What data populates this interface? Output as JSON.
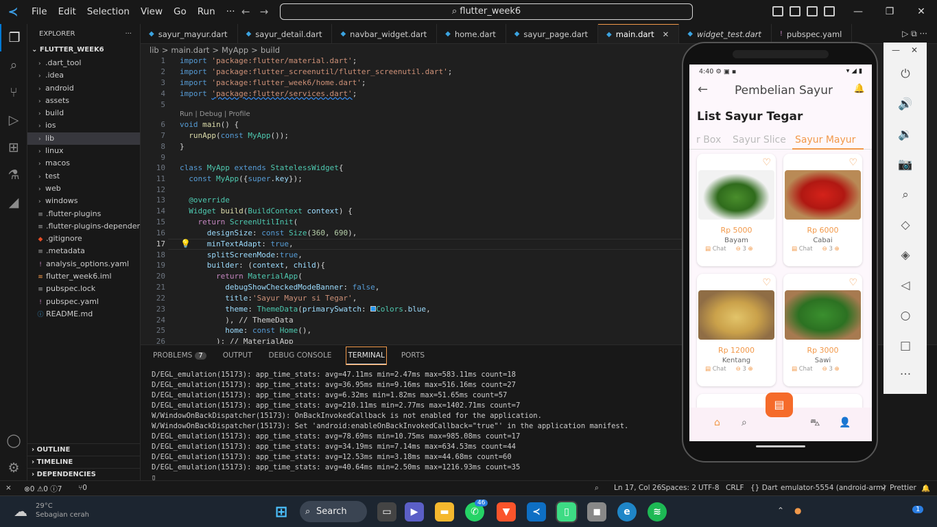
{
  "titlebar": {
    "menu": [
      "File",
      "Edit",
      "Selection",
      "View",
      "Go",
      "Run",
      "···"
    ],
    "search": "flutter_week6"
  },
  "explorer": {
    "header": "EXPLORER",
    "root": "FLUTTER_WEEK6",
    "folders": [
      ".dart_tool",
      ".idea",
      "android",
      "assets",
      "build",
      "ios",
      "lib",
      "linux",
      "macos",
      "test",
      "web",
      "windows"
    ],
    "files": [
      ".flutter-plugins",
      ".flutter-plugins-dependen...",
      ".gitignore",
      ".metadata",
      "analysis_options.yaml",
      "flutter_week6.iml",
      "pubspec.lock",
      "pubspec.yaml",
      "README.md"
    ],
    "sections": [
      "OUTLINE",
      "TIMELINE",
      "DEPENDENCIES"
    ]
  },
  "tabs": [
    "sayur_mayur.dart",
    "sayur_detail.dart",
    "navbar_widget.dart",
    "home.dart",
    "sayur_page.dart",
    "main.dart",
    "widget_test.dart",
    "pubspec.yaml"
  ],
  "breadcrumb": [
    "lib",
    ">",
    "main.dart",
    ">",
    "MyApp",
    ">",
    "build"
  ],
  "editor": {
    "codelens": "Run | Debug | Profile",
    "line_numbers": [
      "1",
      "2",
      "3",
      "4",
      "5",
      "6",
      "7",
      "8",
      "9",
      "10",
      "11",
      "12",
      "13",
      "14",
      "15",
      "16",
      "17",
      "18",
      "19",
      "20",
      "21",
      "22",
      "23",
      "24",
      "25",
      "26"
    ]
  },
  "panel": {
    "tabs": [
      "PROBLEMS",
      "OUTPUT",
      "DEBUG CONSOLE",
      "TERMINAL",
      "PORTS"
    ],
    "problems_count": "7",
    "terminal_lines": [
      "D/EGL_emulation(15173): app_time_stats: avg=47.11ms min=2.47ms max=583.11ms count=18",
      "D/EGL_emulation(15173): app_time_stats: avg=36.95ms min=9.16ms max=516.16ms count=27",
      "D/EGL_emulation(15173): app_time_stats: avg=6.32ms min=1.82ms max=51.65ms count=57",
      "D/EGL_emulation(15173): app_time_stats: avg=210.11ms min=2.77ms max=1402.71ms count=7",
      "W/WindowOnBackDispatcher(15173): OnBackInvokedCallback is not enabled for the application.",
      "W/WindowOnBackDispatcher(15173): Set 'android:enableOnBackInvokedCallback=\"true\"' in the application manifest.",
      "D/EGL_emulation(15173): app_time_stats: avg=78.69ms min=10.75ms max=985.08ms count=17",
      "D/EGL_emulation(15173): app_time_stats: avg=34.19ms min=7.14ms max=634.53ms count=44",
      "D/EGL_emulation(15173): app_time_stats: avg=12.53ms min=3.18ms max=44.68ms count=60",
      "D/EGL_emulation(15173): app_time_stats: avg=40.64ms min=2.50ms max=1216.93ms count=35",
      "▯"
    ]
  },
  "statusbar": {
    "problems": "⊗0 ⚠0 ⓘ7",
    "ports": "⑂0",
    "position": "Ln 17, Col 26",
    "spaces": "Spaces: 2",
    "encoding": "UTF-8",
    "eol": "CRLF",
    "language": "{} Dart",
    "device": "emulator-5554 (android-arm)",
    "formatter": "✓ Prettier"
  },
  "taskbar": {
    "search": "Search",
    "weather_temp": "29°C",
    "weather_desc": "Sebagian cerah",
    "whatsapp_badge": "46",
    "notif_count": "1"
  },
  "phone": {
    "time": "4:40",
    "title": "Pembelian Sayur",
    "list_title": "List Sayur Tegar",
    "tabs": [
      "r Box",
      "Sayur Slice",
      "Sayur Mayur"
    ],
    "products": [
      {
        "price": "Rp 5000",
        "name": "Bayam",
        "chat": "Chat",
        "qty": "3"
      },
      {
        "price": "Rp 6000",
        "name": "Cabai",
        "chat": "Chat",
        "qty": "3"
      },
      {
        "price": "Rp 12000",
        "name": "Kentang",
        "chat": "Chat",
        "qty": "3"
      },
      {
        "price": "Rp 3000",
        "name": "Sawi",
        "chat": "Chat",
        "qty": "3"
      }
    ]
  },
  "colors": {
    "accent": "#f2994a",
    "vscode_blue": "#0078d4"
  }
}
